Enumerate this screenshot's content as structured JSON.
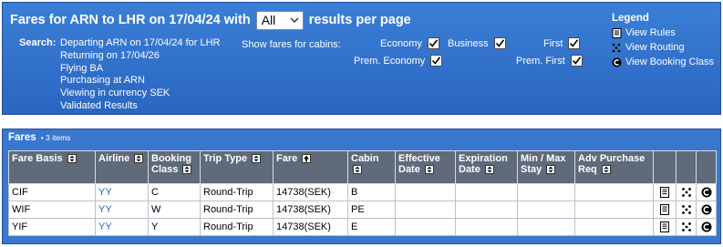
{
  "header": {
    "title_prefix": "Fares for ARN to LHR on 17/04/24 with",
    "results_select": "All",
    "title_suffix": "results per page",
    "search_label": "Search:",
    "search_lines": [
      "Departing ARN on 17/04/24 for LHR",
      "Returning on 17/04/26",
      "Flying BA",
      "Purchasing at ARN",
      "Viewing in currency SEK",
      "Validated Results"
    ],
    "cabins_label": "Show fares for cabins:",
    "cabins": {
      "economy": "Economy",
      "business": "Business",
      "first": "First",
      "prem_economy": "Prem. Economy",
      "prem_first": "Prem. First"
    }
  },
  "legend": {
    "title": "Legend",
    "items": [
      "View Rules",
      "View Routing",
      "View Booking Class"
    ]
  },
  "fares": {
    "title": "Fares",
    "count": "• 3 items",
    "columns": [
      {
        "l1": "Fare Basis",
        "l2": ""
      },
      {
        "l1": "Airline",
        "l2": ""
      },
      {
        "l1": "Booking",
        "l2": "Class"
      },
      {
        "l1": "Trip Type",
        "l2": ""
      },
      {
        "l1": "Fare",
        "l2": ""
      },
      {
        "l1": "Cabin",
        "l2": ""
      },
      {
        "l1": "Effective",
        "l2": "Date"
      },
      {
        "l1": "Expiration",
        "l2": "Date"
      },
      {
        "l1": "Min / Max",
        "l2": "Stay"
      },
      {
        "l1": "Adv Purchase",
        "l2": "Req"
      }
    ],
    "rows": [
      {
        "fare_basis": "CIF",
        "airline": "YY",
        "booking_class": "C",
        "trip_type": "Round-Trip",
        "fare": "14738(SEK)",
        "cabin": "B",
        "effective": "",
        "expiration": "",
        "stay": "",
        "adv": ""
      },
      {
        "fare_basis": "WIF",
        "airline": "YY",
        "booking_class": "W",
        "trip_type": "Round-Trip",
        "fare": "14738(SEK)",
        "cabin": "PE",
        "effective": "",
        "expiration": "",
        "stay": "",
        "adv": ""
      },
      {
        "fare_basis": "YIF",
        "airline": "YY",
        "booking_class": "Y",
        "trip_type": "Round-Trip",
        "fare": "14738(SEK)",
        "cabin": "E",
        "effective": "",
        "expiration": "",
        "stay": "",
        "adv": ""
      }
    ]
  },
  "icons": {
    "rules": "rules-document-icon",
    "routing": "routing-dots-icon",
    "booking_class": "booking-class-c-icon"
  },
  "colors": {
    "header_blue": "#2f6fcc",
    "table_header": "#5f6a7a",
    "link": "#2a5fb0"
  }
}
